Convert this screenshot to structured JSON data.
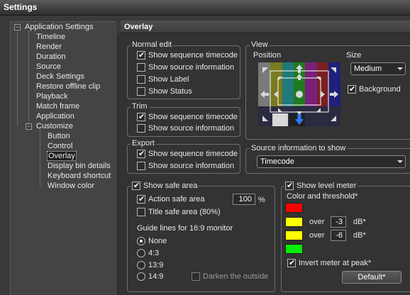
{
  "window": {
    "title": "Settings"
  },
  "tree": {
    "root": "Application Settings",
    "items": [
      "Timeline",
      "Render",
      "Duration",
      "Source",
      "Deck Settings",
      "Restore offline clip",
      "Playback",
      "Match frame",
      "Application"
    ],
    "customize": "Customize",
    "customize_items": [
      "Button",
      "Control",
      "Overlay",
      "Display bin details",
      "Keyboard shortcut",
      "Window color"
    ],
    "selected": "Overlay"
  },
  "panel": {
    "title": "Overlay"
  },
  "normal_edit": {
    "title": "Normal edit",
    "options": [
      {
        "label": "Show sequence timecode",
        "checked": true
      },
      {
        "label": "Show source information",
        "checked": false
      },
      {
        "label": "Show Label",
        "checked": false
      },
      {
        "label": "Show Status",
        "checked": false
      }
    ]
  },
  "trim": {
    "title": "Trim",
    "options": [
      {
        "label": "Show sequence timecode",
        "checked": true
      },
      {
        "label": "Show source information",
        "checked": false
      }
    ]
  },
  "export": {
    "title": "Export",
    "options": [
      {
        "label": "Show sequence timecode",
        "checked": true
      },
      {
        "label": "Show source information",
        "checked": false
      }
    ]
  },
  "view": {
    "title": "View",
    "position_label": "Position",
    "size_label": "Size",
    "size_value": "Medium",
    "background_label": "Background",
    "background_checked": true
  },
  "source_info": {
    "title": "Source information to show",
    "value": "Timecode"
  },
  "safe_area": {
    "title": "Show safe area",
    "checked": true,
    "action_label": "Action safe area",
    "action_checked": true,
    "action_value": "100",
    "action_unit": "%",
    "title_label": "Title safe area (80%)",
    "title_checked": false,
    "guide_label": "Guide lines for 16:9 monitor",
    "radios": [
      {
        "label": "None",
        "selected": true
      },
      {
        "label": "4:3",
        "selected": false
      },
      {
        "label": "13:9",
        "selected": false
      },
      {
        "label": "14:9",
        "selected": false
      }
    ],
    "darken_label": "Darken the outside",
    "darken_checked": false
  },
  "level_meter": {
    "title": "Show level meter",
    "checked": true,
    "color_threshold_label": "Color and threshold*",
    "colors": {
      "red": "#ff0000",
      "yellow": "#ffff00",
      "green": "#00ee00"
    },
    "over_label": "over",
    "db_label": "dB*",
    "threshold_1": "-3",
    "threshold_2": "-6",
    "invert_label": "Invert meter at peak*",
    "invert_checked": true,
    "default_button": "Default*"
  }
}
